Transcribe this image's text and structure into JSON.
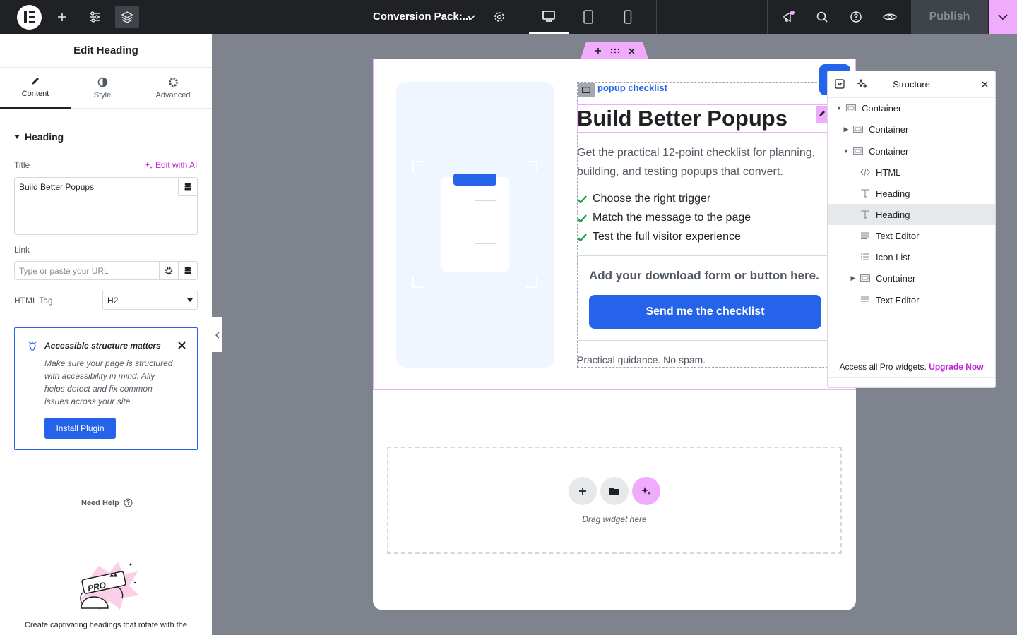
{
  "topbar": {
    "page_title": "Conversion Pack:...",
    "publish_label": "Publish"
  },
  "panel": {
    "title": "Edit Heading",
    "tabs": [
      {
        "label": "Content"
      },
      {
        "label": "Style"
      },
      {
        "label": "Advanced"
      }
    ],
    "section_title": "Heading",
    "title_label": "Title",
    "edit_ai_label": "Edit with AI",
    "title_value": "Build Better Popups",
    "link_label": "Link",
    "link_placeholder": "Type or paste your URL",
    "html_tag_label": "HTML Tag",
    "html_tag_value": "H2",
    "notice": {
      "title": "Accessible structure matters",
      "text": "Make sure your page is structured with accessibility in mind. Ally helps detect and fix common issues across your site.",
      "button": "Install Plugin"
    },
    "need_help": "Need Help",
    "promo_text": "Create captivating headings that rotate with the"
  },
  "canvas": {
    "eyebrow": "popup checklist",
    "heading": "Build Better Popups",
    "paragraph_line1": "Get the practical 12-point checklist for planning,",
    "paragraph_line2": "building, and testing popups that convert.",
    "checklist": [
      "Choose the right trigger",
      "Match the message to the page",
      "Test the full visitor experience"
    ],
    "cta_title": "Add your download form or button here.",
    "cta_button": "Send me the checklist",
    "fine_print": "Practical guidance. No spam.",
    "drop_zone_text": "Drag widget here"
  },
  "structure": {
    "title": "Structure",
    "items": [
      {
        "label": "Container",
        "icon": "container-icon"
      },
      {
        "label": "Container",
        "icon": "container-icon"
      },
      {
        "label": "Container",
        "icon": "container-icon"
      },
      {
        "label": "HTML",
        "icon": "code-icon"
      },
      {
        "label": "Heading",
        "icon": "heading-icon"
      },
      {
        "label": "Heading",
        "icon": "heading-icon"
      },
      {
        "label": "Text Editor",
        "icon": "text-editor-icon"
      },
      {
        "label": "Icon List",
        "icon": "list-icon"
      },
      {
        "label": "Container",
        "icon": "container-icon"
      },
      {
        "label": "Text Editor",
        "icon": "text-editor-icon"
      }
    ],
    "footer_text": "Access all Pro widgets.",
    "footer_link": "Upgrade Now"
  },
  "colors": {
    "accent_blue": "#2563eb",
    "ai_pink": "#f0abfc",
    "ai_link": "#c026d3",
    "dark": "#1f2124"
  }
}
